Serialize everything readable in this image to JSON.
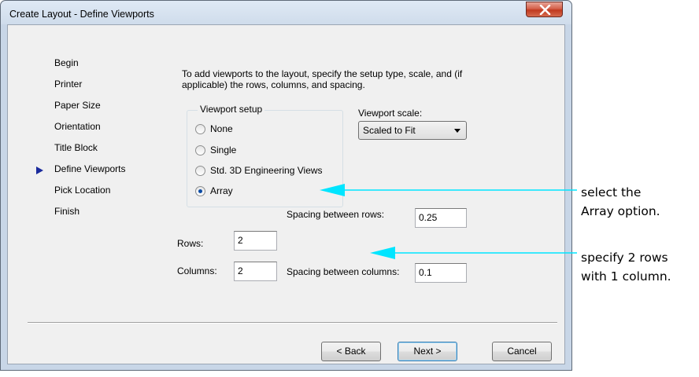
{
  "window": {
    "title": "Create Layout - Define Viewports",
    "close_icon": "close-icon"
  },
  "steps": [
    {
      "label": "Begin",
      "current": false
    },
    {
      "label": "Printer",
      "current": false
    },
    {
      "label": "Paper Size",
      "current": false
    },
    {
      "label": "Orientation",
      "current": false
    },
    {
      "label": "Title Block",
      "current": false
    },
    {
      "label": "Define Viewports",
      "current": true
    },
    {
      "label": "Pick Location",
      "current": false
    },
    {
      "label": "Finish",
      "current": false
    }
  ],
  "intro_text": "To add viewports to the layout, specify the setup type, scale, and (if applicable) the rows, columns, and spacing.",
  "viewport_setup": {
    "label": "Viewport setup",
    "options": [
      {
        "label": "None",
        "checked": false
      },
      {
        "label": "Single",
        "checked": false
      },
      {
        "label": "Std. 3D Engineering Views",
        "checked": false
      },
      {
        "label": "Array",
        "checked": true
      }
    ]
  },
  "viewport_scale": {
    "label": "Viewport scale:",
    "value": "Scaled to Fit"
  },
  "fields": {
    "rows_label": "Rows:",
    "rows_value": "2",
    "columns_label": "Columns:",
    "columns_value": "2",
    "spacing_rows_label": "Spacing between rows:",
    "spacing_rows_value": "0.25",
    "spacing_columns_label": "Spacing between columns:",
    "spacing_columns_value": "0.1"
  },
  "buttons": {
    "back": "< Back",
    "next": "Next >",
    "cancel": "Cancel"
  },
  "annotations": {
    "callout_1_line1": "select the",
    "callout_1_line2": "Array option.",
    "callout_2_line1": "specify 2 rows",
    "callout_2_line2": "with 1 column.",
    "arrow_color": "#00e5ff"
  }
}
